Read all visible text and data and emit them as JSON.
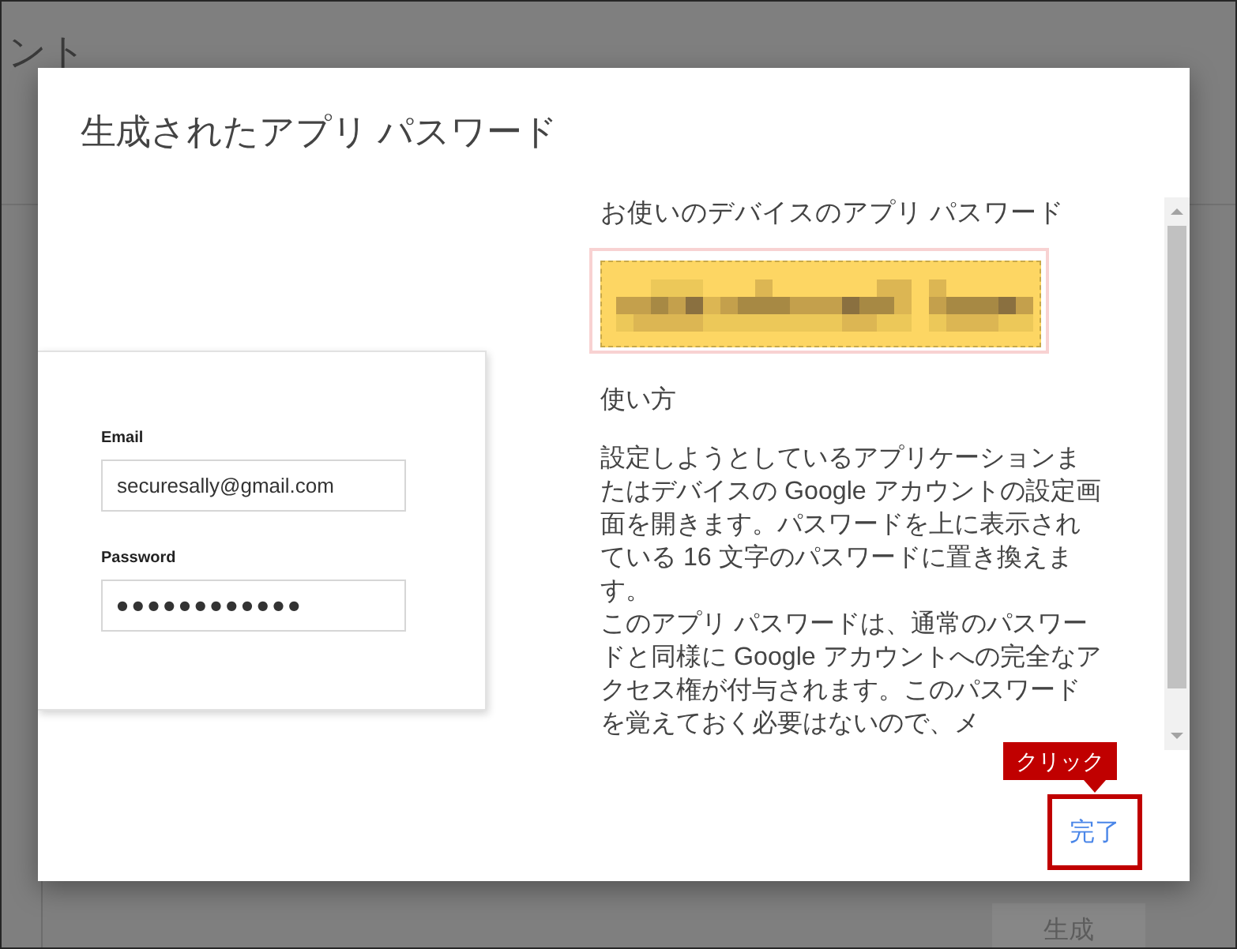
{
  "background": {
    "page_title": "ント",
    "button": "生成"
  },
  "dialog": {
    "title": "生成されたアプリ パスワード",
    "illustration": {
      "fields": [
        {
          "kind": "text",
          "label": "Email",
          "value": "securesally@gmail.com"
        },
        {
          "kind": "password",
          "label": "Password",
          "value": "●●●●●●●●●●●●"
        }
      ]
    },
    "password_section": {
      "heading": "お使いのデバイスのアプリ パスワード",
      "highlighted": true
    },
    "instructions": {
      "heading": "使い方",
      "paragraphs": [
        "設定しようとしているアプリケーションまたはデバイスの Google アカウントの設定画面を開きます。パスワードを上に表示されている 16 文字のパスワードに置き換えます。",
        "このアプリ パスワードは、通常のパスワードと同様に Google アカウントへの完全なアクセス権が付与されます。このパスワードを覚えておく必要はないので、メ"
      ]
    },
    "done_button": {
      "label": "完了",
      "highlighted": true
    },
    "callout": "クリック"
  }
}
